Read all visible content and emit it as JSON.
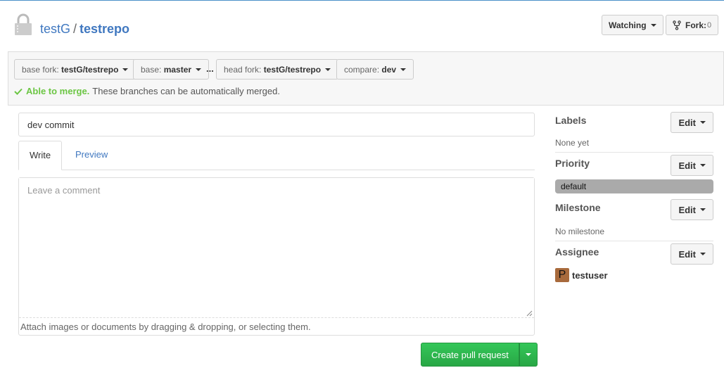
{
  "repo": {
    "owner": "testG",
    "separator": "/",
    "name": "testrepo"
  },
  "header": {
    "watch_label": "Watching",
    "fork_label": "Fork:",
    "fork_count": "0"
  },
  "compare": {
    "base_fork_label": "base fork:",
    "base_fork_value": "testG/testrepo",
    "base_label": "base:",
    "base_value": "master",
    "dots": "...",
    "head_fork_label": "head fork:",
    "head_fork_value": "testG/testrepo",
    "compare_label": "compare:",
    "compare_value": "dev",
    "merge_ok": "Able to merge.",
    "merge_text": "These branches can be automatically merged."
  },
  "form": {
    "title_value": "dev commit",
    "tabs": [
      {
        "label": "Write"
      },
      {
        "label": "Preview"
      }
    ],
    "comment_placeholder": "Leave a comment",
    "attach_hint": "Attach images or documents by dragging & dropping, or selecting them.",
    "create_label": "Create pull request"
  },
  "sidebar": {
    "labels": {
      "heading": "Labels",
      "edit": "Edit",
      "value": "None yet"
    },
    "priority": {
      "heading": "Priority",
      "edit": "Edit",
      "value": "default"
    },
    "milestone": {
      "heading": "Milestone",
      "edit": "Edit",
      "value": "No milestone"
    },
    "assignee": {
      "heading": "Assignee",
      "edit": "Edit",
      "avatar_letter": "P",
      "name": "testuser"
    }
  },
  "colors": {
    "accent": "#4078c0",
    "success": "#6cc644",
    "create_button": "#2cbe4e",
    "priority_pill": "#aaaaaa",
    "avatar": "#a86a3c"
  },
  "icons": [
    "lock-icon",
    "fork-icon",
    "check-icon",
    "chevron-down-icon",
    "resize-grip-icon"
  ]
}
